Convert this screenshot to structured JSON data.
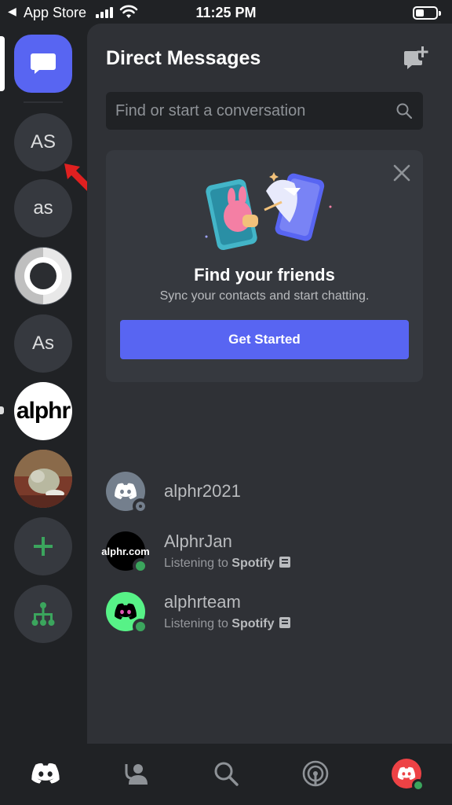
{
  "status_bar": {
    "back_label": "App Store",
    "time": "11:25 PM"
  },
  "servers": [
    {
      "label": "AS"
    },
    {
      "label": "as"
    },
    {
      "label": ""
    },
    {
      "label": "As"
    },
    {
      "label": "alphr"
    }
  ],
  "panel": {
    "title": "Direct Messages",
    "search_placeholder": "Find or start a conversation"
  },
  "friends_card": {
    "title": "Find your friends",
    "subtitle": "Sync your contacts and start chatting.",
    "button_label": "Get Started"
  },
  "dms": [
    {
      "name": "alphr2021",
      "activity_prefix": "",
      "activity_app": "",
      "status": "offline",
      "avatar_color": "#747f8d"
    },
    {
      "name": "AlphrJan",
      "activity_prefix": "Listening to ",
      "activity_app": "Spotify",
      "status": "online",
      "avatar_color": "#000000",
      "avatar_text": "alphr.com"
    },
    {
      "name": "alphrteam",
      "activity_prefix": "Listening to ",
      "activity_app": "Spotify",
      "status": "online",
      "avatar_color": "#57f287"
    }
  ],
  "colors": {
    "blurple": "#5865f2",
    "online": "#3ba55d",
    "offline": "#747f8d",
    "add_green": "#3ba55d"
  },
  "icons": [
    "discord-logo-icon",
    "add-server-icon",
    "explore-icon",
    "new-dm-icon",
    "search-icon",
    "close-icon",
    "friends-icon",
    "mentions-icon",
    "profile-icon"
  ]
}
